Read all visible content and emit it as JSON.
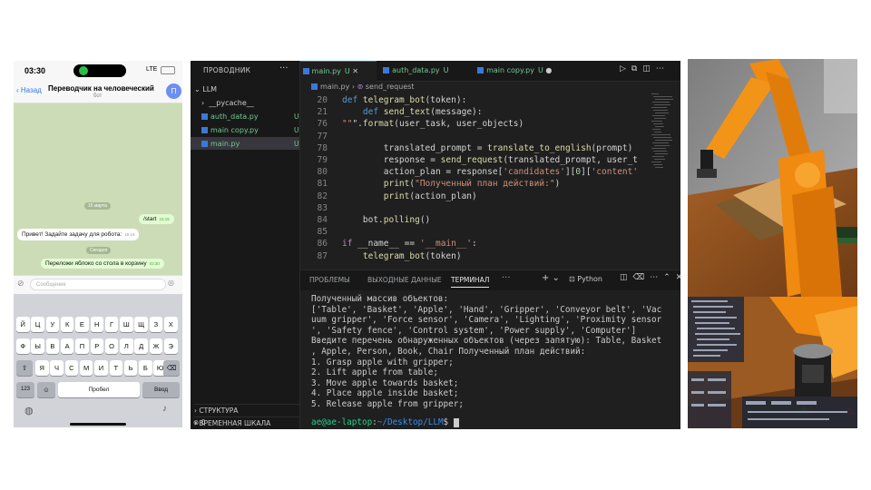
{
  "phone": {
    "time": "03:30",
    "network": "LTE",
    "back_label": "Назад",
    "chat_title": "Переводчик на человеческий",
    "chat_subtitle": "бот",
    "avatar_letter": "П",
    "messages": [
      {
        "type": "date",
        "text": "15 марта"
      },
      {
        "type": "out",
        "text": "/start",
        "time": "15:15"
      },
      {
        "type": "in",
        "text": "Привет! Задайте задачу для робота:",
        "time": "15:15"
      },
      {
        "type": "date",
        "text": "Сегодня"
      },
      {
        "type": "out",
        "text": "Переложи яблоко со стола в корзину",
        "time": "03:30"
      }
    ],
    "input_placeholder": "Сообщение",
    "keyboard": {
      "row1": [
        "Й",
        "Ц",
        "У",
        "К",
        "Е",
        "Н",
        "Г",
        "Ш",
        "Щ",
        "З",
        "Х"
      ],
      "row2": [
        "Ф",
        "Ы",
        "В",
        "А",
        "П",
        "Р",
        "О",
        "Л",
        "Д",
        "Ж",
        "Э"
      ],
      "row3": [
        "Я",
        "Ч",
        "С",
        "М",
        "И",
        "Т",
        "Ь",
        "Б",
        "Ю"
      ],
      "numbers_key": "123",
      "space_key": "Пробел",
      "enter_key": "Ввод"
    }
  },
  "vscode": {
    "explorer_title": "ПРОВОДНИК",
    "folder": "LLM",
    "tree": [
      {
        "name": "__pycache__",
        "badge": ""
      },
      {
        "name": "auth_data.py",
        "badge": "U"
      },
      {
        "name": "main copy.py",
        "badge": "U"
      },
      {
        "name": "main.py",
        "badge": "U"
      }
    ],
    "outline_label": "СТРУКТУРА",
    "timeline_label": "ВРЕМЕННАЯ ШКАЛА",
    "status_warnings": "0",
    "tabs": [
      {
        "label": "main.py",
        "badge": "U",
        "close": "✕"
      },
      {
        "label": "auth_data.py",
        "badge": "U"
      },
      {
        "label": "main copy.py",
        "badge": "U",
        "dot": "●"
      }
    ],
    "breadcrumb": [
      "main.py",
      "send_request"
    ],
    "code_lines": [
      {
        "n": "20",
        "text": "def telegram_bot(token):"
      },
      {
        "n": "21",
        "text": "    def send_text(message):"
      },
      {
        "n": "76",
        "text": "\"\"\".format(user_task, user_objects)"
      },
      {
        "n": "77",
        "text": ""
      },
      {
        "n": "78",
        "text": "        translated_prompt = translate_to_english(prompt)"
      },
      {
        "n": "79",
        "text": "        response = send_request(translated_prompt, user_t"
      },
      {
        "n": "80",
        "text": "        action_plan = response['candidates'][0]['content'"
      },
      {
        "n": "81",
        "text": "        print(\"Полученный план действий:\")"
      },
      {
        "n": "82",
        "text": "        print(action_plan)"
      },
      {
        "n": "83",
        "text": ""
      },
      {
        "n": "84",
        "text": "    bot.polling()"
      },
      {
        "n": "85",
        "text": ""
      },
      {
        "n": "86",
        "text": "if __name__ == '__main__':"
      },
      {
        "n": "87",
        "text": "    telegram_bot(token)"
      }
    ],
    "panel_tabs": [
      "ПРОБЛЕМЫ",
      "ВЫХОДНЫЕ ДАННЫЕ",
      "ТЕРМИНАЛ"
    ],
    "panel_active": "ТЕРМИНАЛ",
    "terminal_profile": "Python",
    "terminal_lines": [
      "Полученный массив объектов:",
      "['Table', 'Basket', 'Apple', 'Hand', 'Gripper', 'Conveyor belt', 'Vac",
      "uum gripper', 'Force sensor', 'Camera', 'Lighting', 'Proximity sensor",
      "', 'Safety fence', 'Control system', 'Power supply', 'Computer']",
      "Введите перечень обнаруженных объектов (через запятую): Table, Basket",
      ", Apple, Person, Book, Chair Полученный план действий:",
      "1. Grasp apple with gripper;",
      "2. Lift apple from table;",
      "3. Move apple towards basket;",
      "4. Place apple inside basket;",
      "5. Release apple from gripper;"
    ],
    "prompt_user": "ae@ae-laptop",
    "prompt_path": "~/Desktop/LLM",
    "prompt_symbol": "$"
  },
  "colors": {
    "robot_orange": "#f08a10",
    "floor_wood": "#8a4f1f",
    "vscode_bg": "#1f1f1f",
    "git_untracked": "#73c991",
    "telegram_bg": "#ccdcb6"
  }
}
